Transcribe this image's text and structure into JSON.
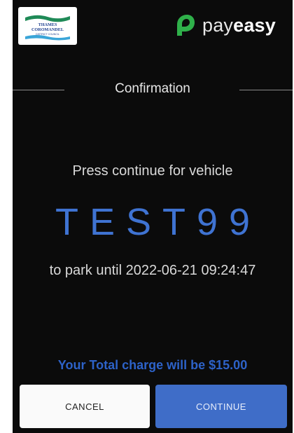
{
  "header": {
    "council_logo": {
      "line1": "THAMES",
      "line2": "COROMANDEL",
      "line3": "DISTRICT COUNCIL"
    },
    "brand": {
      "name_light": "pay",
      "name_bold": "easy",
      "icon": "payeasy-leaf-icon"
    }
  },
  "screen": {
    "title": "Confirmation",
    "prompt": "Press continue for vehicle",
    "plate": "TEST99",
    "park_until": "to park until 2022-06-21 09:24:47",
    "total_charge": "Your Total charge will be $15.00"
  },
  "actions": {
    "cancel_label": "CANCEL",
    "continue_label": "CONTINUE"
  },
  "colors": {
    "background": "#0b0b0b",
    "accent_blue": "#3f73d2",
    "brand_green": "#2fb04a"
  }
}
